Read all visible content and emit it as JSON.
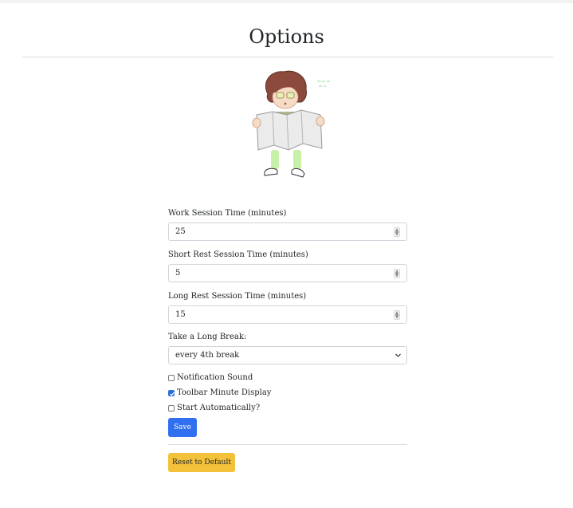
{
  "page": {
    "title": "Options"
  },
  "form": {
    "work": {
      "label": "Work Session Time (minutes)",
      "value": "25"
    },
    "short_rest": {
      "label": "Short Rest Session Time (minutes)",
      "value": "5"
    },
    "long_rest": {
      "label": "Long Rest Session Time (minutes)",
      "value": "15"
    },
    "long_break": {
      "label": "Take a Long Break:",
      "selected": "every 4th break"
    },
    "checkboxes": {
      "notification_sound": {
        "label": "Notification Sound",
        "checked": false
      },
      "toolbar_minute_display": {
        "label": "Toolbar Minute Display",
        "checked": true
      },
      "start_automatically": {
        "label": "Start Automatically?",
        "checked": false
      }
    },
    "save_label": "Save",
    "reset_label": "Reset to Default"
  },
  "icons": {
    "spinner": "number-spinner-icon",
    "select": "chevron-down-icon",
    "check": "checkmark-icon"
  },
  "colors": {
    "save": "#2f6ff0",
    "reset": "#f3c13a",
    "checkbox_checked": "#2a6fdb"
  }
}
